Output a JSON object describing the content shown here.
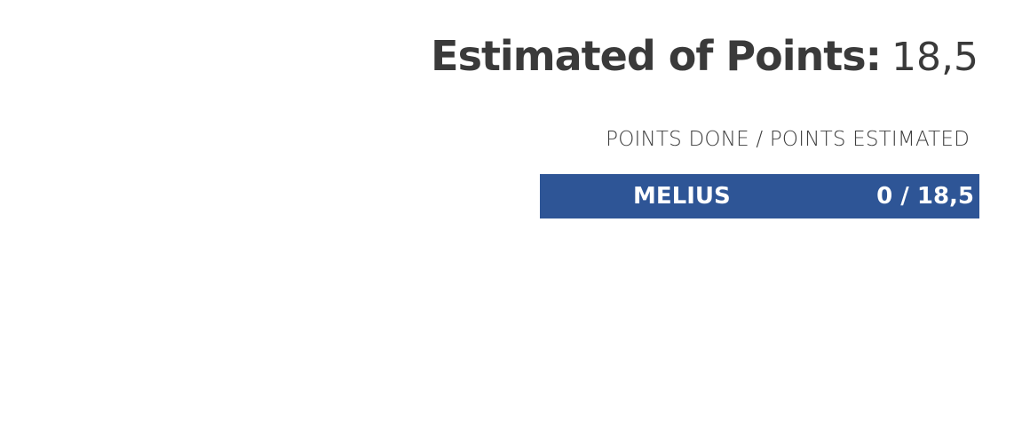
{
  "header": {
    "label": "Estimated of Points:",
    "value": "18,5"
  },
  "columns": {
    "points_header": "POINTS DONE /  POINTS ESTIMATED"
  },
  "members": [
    {
      "name": "MELIUS",
      "points": "0 / 18,5"
    }
  ],
  "colors": {
    "row_background": "#2e5596",
    "heading_text": "#3a3a3a",
    "row_text": "#ffffff"
  }
}
